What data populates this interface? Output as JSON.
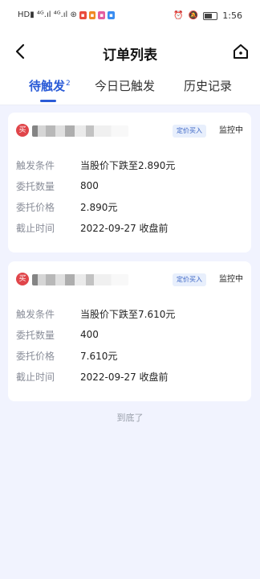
{
  "statusbar": {
    "time": "1:56"
  },
  "header": {
    "title": "订单列表"
  },
  "tabs": [
    {
      "label": "待触发",
      "badge": "2"
    },
    {
      "label": "今日已触发"
    },
    {
      "label": "历史记录"
    }
  ],
  "colors": {
    "accent": "#2a5bd7",
    "buy": "#e0454a",
    "tag_bg": "#e8effc"
  },
  "orders": [
    {
      "side_badge": "买",
      "type_tag": "定价买入",
      "status": "监控中",
      "fields": [
        {
          "label": "触发条件",
          "value": "当股价下跌至2.890元"
        },
        {
          "label": "委托数量",
          "value": "800"
        },
        {
          "label": "委托价格",
          "value": "2.890元"
        },
        {
          "label": "截止时间",
          "value": "2022-09-27 收盘前"
        }
      ]
    },
    {
      "side_badge": "买",
      "type_tag": "定价买入",
      "status": "监控中",
      "fields": [
        {
          "label": "触发条件",
          "value": "当股价下跌至7.610元"
        },
        {
          "label": "委托数量",
          "value": "400"
        },
        {
          "label": "委托价格",
          "value": "7.610元"
        },
        {
          "label": "截止时间",
          "value": "2022-09-27 收盘前"
        }
      ]
    }
  ],
  "footer": {
    "end_text": "到底了"
  }
}
